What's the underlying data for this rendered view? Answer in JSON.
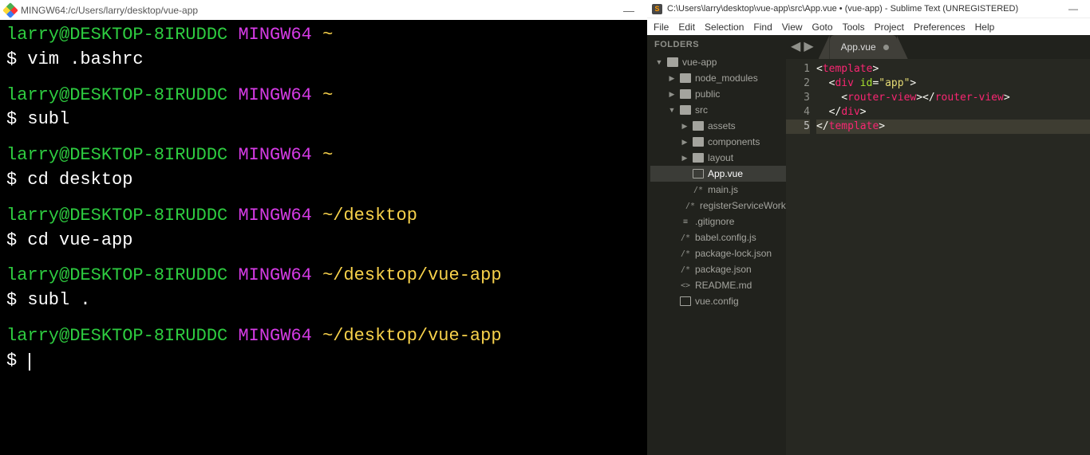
{
  "terminal": {
    "title": "MINGW64:/c/Users/larry/desktop/vue-app",
    "minimize": "—",
    "user": "larry@DESKTOP-8IRUDDC",
    "host": "MINGW64",
    "blocks": [
      {
        "path": "~",
        "cmd": "vim .bashrc"
      },
      {
        "path": "~",
        "cmd": "subl"
      },
      {
        "path": "~",
        "cmd": "cd desktop"
      },
      {
        "path": "~/desktop",
        "cmd": "cd vue-app"
      },
      {
        "path": "~/desktop/vue-app",
        "cmd": "subl ."
      },
      {
        "path": "~/desktop/vue-app",
        "cmd": ""
      }
    ]
  },
  "sublime": {
    "title": "C:\\Users\\larry\\desktop\\vue-app\\src\\App.vue • (vue-app) - Sublime Text (UNREGISTERED)",
    "minimize": "—",
    "menu": [
      "File",
      "Edit",
      "Selection",
      "Find",
      "View",
      "Goto",
      "Tools",
      "Project",
      "Preferences",
      "Help"
    ],
    "sidebar": {
      "header": "FOLDERS",
      "root": "vue-app",
      "children": [
        {
          "type": "folder",
          "name": "node_modules",
          "open": false,
          "depth": 1
        },
        {
          "type": "folder",
          "name": "public",
          "open": false,
          "depth": 1
        },
        {
          "type": "folder",
          "name": "src",
          "open": true,
          "depth": 1
        },
        {
          "type": "folder",
          "name": "assets",
          "open": false,
          "depth": 2
        },
        {
          "type": "folder",
          "name": "components",
          "open": false,
          "depth": 2
        },
        {
          "type": "folder",
          "name": "layout",
          "open": false,
          "depth": 2
        },
        {
          "type": "file",
          "name": "App.vue",
          "icon": "file",
          "depth": 2,
          "selected": true
        },
        {
          "type": "file",
          "name": "main.js",
          "icon": "comment",
          "depth": 2
        },
        {
          "type": "file",
          "name": "registerServiceWorker.js",
          "icon": "comment",
          "depth": 2
        },
        {
          "type": "file",
          "name": ".gitignore",
          "icon": "list",
          "depth": 1
        },
        {
          "type": "file",
          "name": "babel.config.js",
          "icon": "comment",
          "depth": 1
        },
        {
          "type": "file",
          "name": "package-lock.json",
          "icon": "comment",
          "depth": 1
        },
        {
          "type": "file",
          "name": "package.json",
          "icon": "comment",
          "depth": 1
        },
        {
          "type": "file",
          "name": "README.md",
          "icon": "angle",
          "depth": 1
        },
        {
          "type": "file",
          "name": "vue.config",
          "icon": "file",
          "depth": 1
        }
      ]
    },
    "tab": {
      "label": "App.vue",
      "dirty": true
    },
    "code": {
      "lines": [
        {
          "n": 1,
          "tokens": [
            [
              "lt",
              "<"
            ],
            [
              "tag",
              "template"
            ],
            [
              "lt",
              ">"
            ]
          ]
        },
        {
          "n": 2,
          "tokens": [
            [
              "lt",
              "  <"
            ],
            [
              "tag",
              "div"
            ],
            [
              "punc",
              " "
            ],
            [
              "attr",
              "id"
            ],
            [
              "punc",
              "="
            ],
            [
              "str",
              "\"app\""
            ],
            [
              "lt",
              ">"
            ]
          ]
        },
        {
          "n": 3,
          "tokens": [
            [
              "lt",
              "    <"
            ],
            [
              "tag",
              "router-view"
            ],
            [
              "lt",
              "></"
            ],
            [
              "tag",
              "router-view"
            ],
            [
              "lt",
              ">"
            ]
          ]
        },
        {
          "n": 4,
          "tokens": [
            [
              "lt",
              "  </"
            ],
            [
              "tag",
              "div"
            ],
            [
              "lt",
              ">"
            ]
          ]
        },
        {
          "n": 5,
          "active": true,
          "tokens": [
            [
              "lt",
              "</"
            ],
            [
              "tag",
              "template"
            ],
            [
              "lt",
              ">"
            ]
          ]
        }
      ]
    }
  }
}
